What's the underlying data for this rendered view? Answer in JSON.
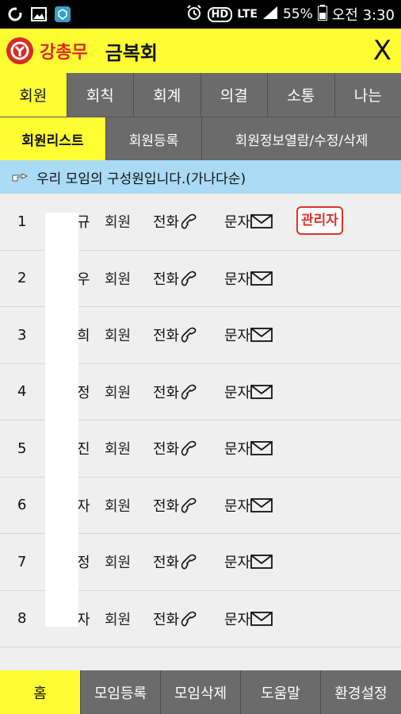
{
  "status_bar": {
    "left_icons": [
      "notification-icon",
      "image-icon",
      "app-icon"
    ],
    "hd_label": "HD",
    "lte_label": "LTE",
    "battery_percent": "55%",
    "time": "오전 3:30"
  },
  "header": {
    "brand": "강총무",
    "group_name": "금복회",
    "close_label": "X"
  },
  "main_tabs": [
    {
      "label": "회원",
      "active": true
    },
    {
      "label": "회칙",
      "active": false
    },
    {
      "label": "회계",
      "active": false
    },
    {
      "label": "의결",
      "active": false
    },
    {
      "label": "소통",
      "active": false
    },
    {
      "label": "나는",
      "active": false
    }
  ],
  "sub_tabs": [
    {
      "label": "회원리스트",
      "active": true
    },
    {
      "label": "회원등록",
      "active": false
    },
    {
      "label": "회원정보열람/수정/삭제",
      "active": false
    }
  ],
  "info_text": "우리 모임의 구성원입니다.(가나다순)",
  "members": [
    {
      "num": "1",
      "name": "규",
      "role": "회원",
      "phone_label": "전화",
      "sms_label": "문자",
      "badge": "관리자"
    },
    {
      "num": "2",
      "name": "우",
      "role": "회원",
      "phone_label": "전화",
      "sms_label": "문자",
      "badge": ""
    },
    {
      "num": "3",
      "name": "희",
      "role": "회원",
      "phone_label": "전화",
      "sms_label": "문자",
      "badge": ""
    },
    {
      "num": "4",
      "name": "정",
      "role": "회원",
      "phone_label": "전화",
      "sms_label": "문자",
      "badge": ""
    },
    {
      "num": "5",
      "name": "진",
      "role": "회원",
      "phone_label": "전화",
      "sms_label": "문자",
      "badge": ""
    },
    {
      "num": "6",
      "name": "자",
      "role": "회원",
      "phone_label": "전화",
      "sms_label": "문자",
      "badge": ""
    },
    {
      "num": "7",
      "name": "정",
      "role": "회원",
      "phone_label": "전화",
      "sms_label": "문자",
      "badge": ""
    },
    {
      "num": "8",
      "name": "자",
      "role": "회원",
      "phone_label": "전화",
      "sms_label": "문자",
      "badge": ""
    }
  ],
  "bottom_nav": [
    {
      "label": "홈",
      "active": true
    },
    {
      "label": "모임등록",
      "active": false
    },
    {
      "label": "모임삭제",
      "active": false
    },
    {
      "label": "도움말",
      "active": false
    },
    {
      "label": "환경설정",
      "active": false
    }
  ],
  "colors": {
    "accent_yellow": "#ffff33",
    "brand_red": "#d92b25",
    "tab_gray": "#6b6b6b",
    "info_blue": "#a9dbf4"
  }
}
